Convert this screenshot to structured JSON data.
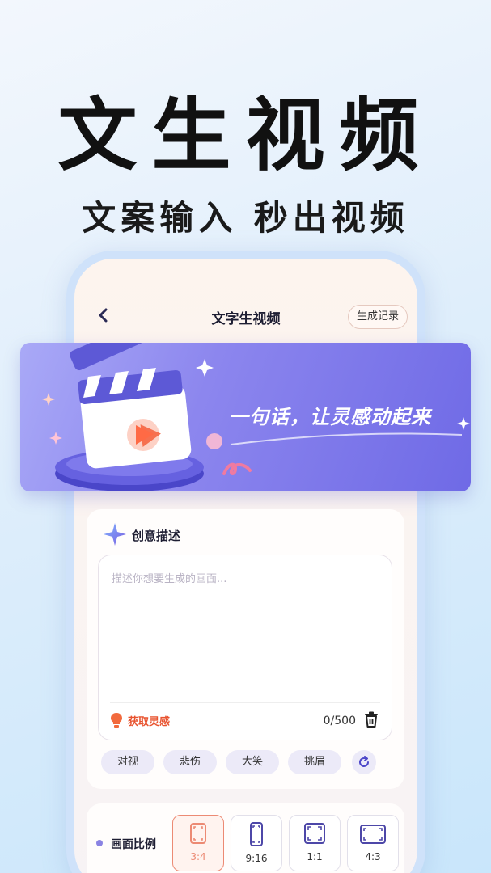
{
  "hero": {
    "title": "文生视频",
    "subtitle": "文案输入 秒出视频"
  },
  "nav": {
    "title": "文字生视频",
    "history_label": "生成记录"
  },
  "banner": {
    "slogan": "一句话，让灵感动起来"
  },
  "creative": {
    "section_title": "创意描述",
    "placeholder": "描述你想要生成的画面...",
    "inspire_label": "获取灵感",
    "counter": "0/500",
    "tags": [
      "对视",
      "悲伤",
      "大笑",
      "挑眉"
    ]
  },
  "ratio": {
    "label": "画面比例",
    "options": [
      "3:4",
      "9:16",
      "1:1",
      "4:3"
    ],
    "selected": "3:4"
  },
  "colors": {
    "accent_purple": "#7b75e8",
    "accent_orange": "#e8532f"
  }
}
